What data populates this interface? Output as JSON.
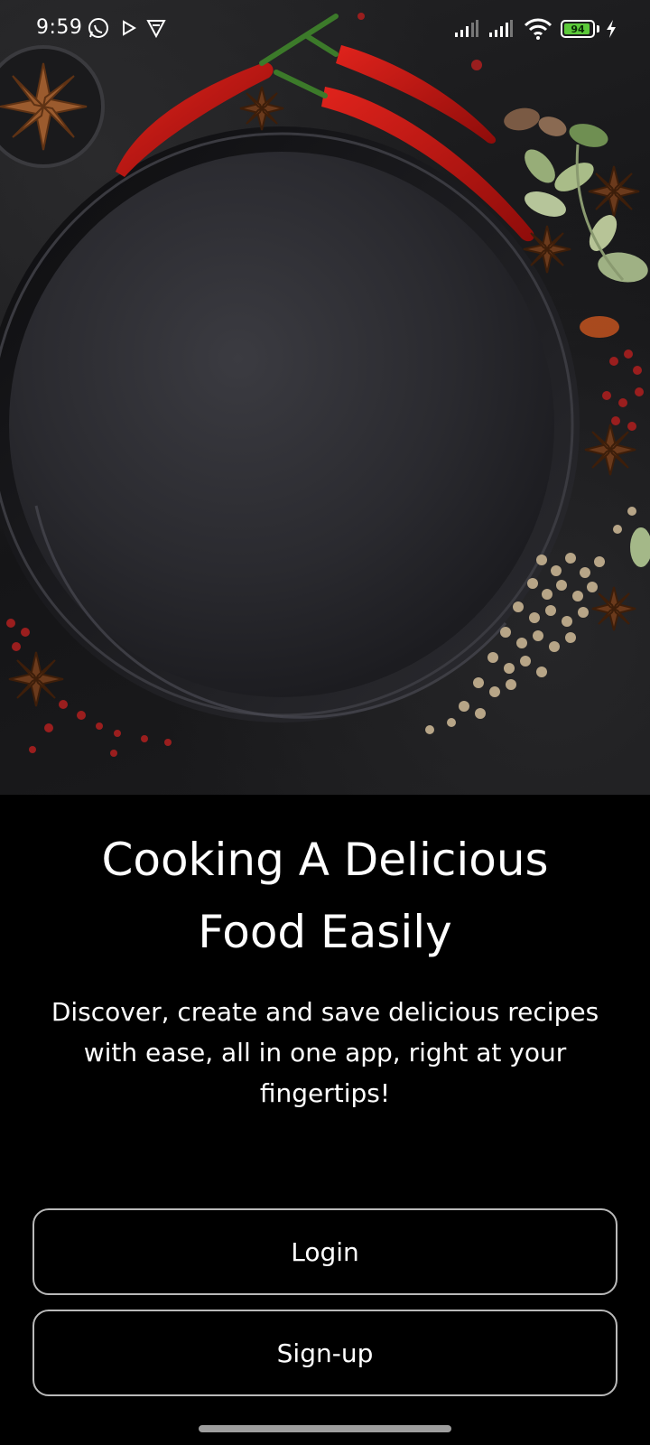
{
  "status_bar": {
    "time": "9:59",
    "battery_level": "94",
    "battery_fraction": 0.94,
    "icons": [
      "whatsapp-icon",
      "play-icon",
      "vpn-shield-icon",
      "signal-icon",
      "signal-icon",
      "wifi-icon",
      "battery-icon",
      "charging-icon"
    ]
  },
  "onboarding": {
    "headline_line1": "Cooking A Delicious",
    "headline_line2": "Food Easily",
    "description": "Discover, create and save delicious recipes with ease, all in one app, right at your fingertips!"
  },
  "actions": {
    "login_label": "Login",
    "signup_label": "Sign-up"
  },
  "colors": {
    "background": "#000000",
    "button_border": "#b9b9b9",
    "battery_fill": "#5cc93a"
  }
}
